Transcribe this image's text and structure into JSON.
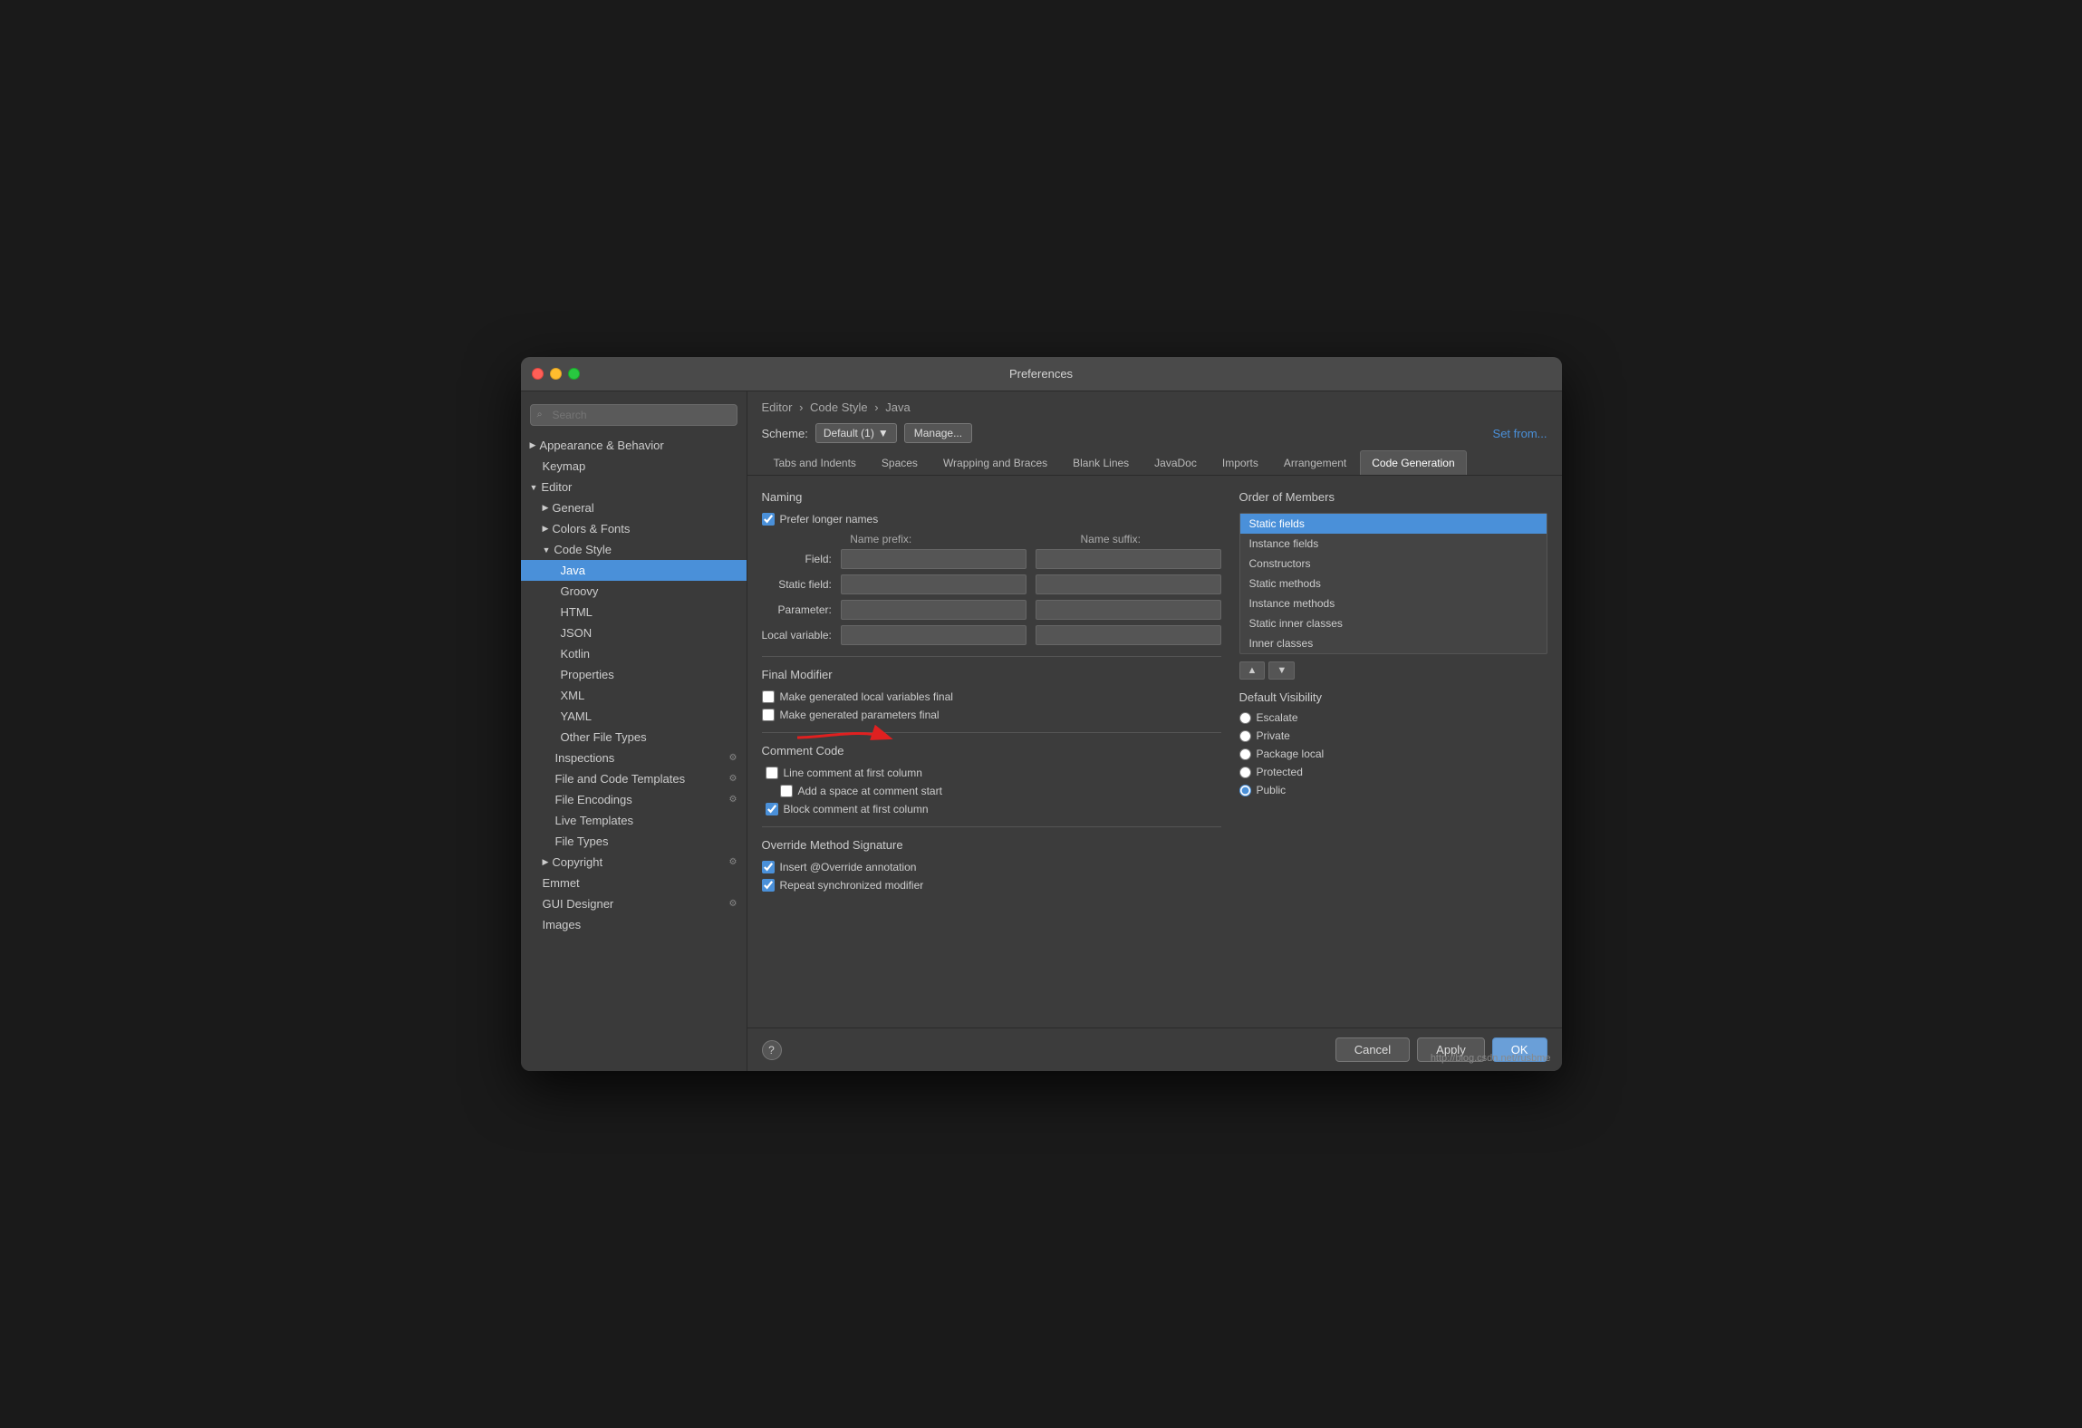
{
  "window": {
    "title": "Preferences"
  },
  "sidebar": {
    "search_placeholder": "Search",
    "items": [
      {
        "id": "appearance",
        "label": "Appearance & Behavior",
        "level": 0,
        "expandable": true,
        "expanded": false
      },
      {
        "id": "keymap",
        "label": "Keymap",
        "level": 0,
        "expandable": false
      },
      {
        "id": "editor",
        "label": "Editor",
        "level": 0,
        "expandable": true,
        "expanded": true
      },
      {
        "id": "general",
        "label": "General",
        "level": 1,
        "expandable": true,
        "expanded": false
      },
      {
        "id": "colors-fonts",
        "label": "Colors & Fonts",
        "level": 1,
        "expandable": true,
        "expanded": false
      },
      {
        "id": "code-style",
        "label": "Code Style",
        "level": 1,
        "expandable": true,
        "expanded": true
      },
      {
        "id": "java",
        "label": "Java",
        "level": 2,
        "expandable": false,
        "active": true
      },
      {
        "id": "groovy",
        "label": "Groovy",
        "level": 2,
        "expandable": false
      },
      {
        "id": "html",
        "label": "HTML",
        "level": 2,
        "expandable": false
      },
      {
        "id": "json",
        "label": "JSON",
        "level": 2,
        "expandable": false
      },
      {
        "id": "kotlin",
        "label": "Kotlin",
        "level": 2,
        "expandable": false
      },
      {
        "id": "properties",
        "label": "Properties",
        "level": 2,
        "expandable": false
      },
      {
        "id": "xml",
        "label": "XML",
        "level": 2,
        "expandable": false
      },
      {
        "id": "yaml",
        "label": "YAML",
        "level": 2,
        "expandable": false
      },
      {
        "id": "other-file-types",
        "label": "Other File Types",
        "level": 2,
        "expandable": false
      },
      {
        "id": "inspections",
        "label": "Inspections",
        "level": 1,
        "expandable": false,
        "has_icon": true
      },
      {
        "id": "file-code-templates",
        "label": "File and Code Templates",
        "level": 1,
        "expandable": false,
        "has_icon": true
      },
      {
        "id": "file-encodings",
        "label": "File Encodings",
        "level": 1,
        "expandable": false,
        "has_icon": true
      },
      {
        "id": "live-templates",
        "label": "Live Templates",
        "level": 1,
        "expandable": false
      },
      {
        "id": "file-types",
        "label": "File Types",
        "level": 1,
        "expandable": false
      },
      {
        "id": "copyright",
        "label": "Copyright",
        "level": 1,
        "expandable": true,
        "expanded": false,
        "has_icon": true
      },
      {
        "id": "emmet",
        "label": "Emmet",
        "level": 0,
        "expandable": false
      },
      {
        "id": "gui-designer",
        "label": "GUI Designer",
        "level": 0,
        "expandable": false,
        "has_icon": true
      },
      {
        "id": "images",
        "label": "Images",
        "level": 0,
        "expandable": false
      }
    ]
  },
  "breadcrumb": {
    "parts": [
      "Editor",
      "Code Style",
      "Java"
    ]
  },
  "scheme": {
    "label": "Scheme:",
    "value": "Default (1)",
    "manage_label": "Manage...",
    "set_from_label": "Set from..."
  },
  "tabs": [
    {
      "id": "tabs-indents",
      "label": "Tabs and Indents"
    },
    {
      "id": "spaces",
      "label": "Spaces"
    },
    {
      "id": "wrapping-braces",
      "label": "Wrapping and Braces"
    },
    {
      "id": "blank-lines",
      "label": "Blank Lines"
    },
    {
      "id": "javadoc",
      "label": "JavaDoc"
    },
    {
      "id": "imports",
      "label": "Imports"
    },
    {
      "id": "arrangement",
      "label": "Arrangement"
    },
    {
      "id": "code-generation",
      "label": "Code Generation",
      "active": true
    }
  ],
  "naming": {
    "title": "Naming",
    "prefer_longer": "Prefer longer names",
    "name_prefix_label": "Name prefix:",
    "name_suffix_label": "Name suffix:",
    "fields": [
      {
        "label": "Field:"
      },
      {
        "label": "Static field:"
      },
      {
        "label": "Parameter:"
      },
      {
        "label": "Local variable:"
      }
    ]
  },
  "final_modifier": {
    "title": "Final Modifier",
    "items": [
      {
        "label": "Make generated local variables final"
      },
      {
        "label": "Make generated parameters final"
      }
    ]
  },
  "comment_code": {
    "title": "Comment Code",
    "items": [
      {
        "label": "Line comment at first column",
        "checked": false
      },
      {
        "label": "Add a space at comment start",
        "checked": false
      },
      {
        "label": "Block comment at first column",
        "checked": true
      }
    ]
  },
  "override_method": {
    "title": "Override Method Signature",
    "items": [
      {
        "label": "Insert @Override annotation",
        "checked": true
      },
      {
        "label": "Repeat synchronized modifier",
        "checked": true
      }
    ]
  },
  "order_of_members": {
    "title": "Order of Members",
    "items": [
      {
        "label": "Static fields",
        "selected": true
      },
      {
        "label": "Instance fields"
      },
      {
        "label": "Constructors"
      },
      {
        "label": "Static methods"
      },
      {
        "label": "Instance methods"
      },
      {
        "label": "Static inner classes"
      },
      {
        "label": "Inner classes"
      }
    ]
  },
  "default_visibility": {
    "title": "Default Visibility",
    "options": [
      {
        "label": "Escalate",
        "selected": false
      },
      {
        "label": "Private",
        "selected": false
      },
      {
        "label": "Package local",
        "selected": false
      },
      {
        "label": "Protected",
        "selected": false
      },
      {
        "label": "Public",
        "selected": true
      }
    ]
  },
  "buttons": {
    "cancel": "Cancel",
    "apply": "Apply",
    "ok": "OK",
    "help": "?"
  },
  "watermark": "http://blog.csdn.net/rusbme"
}
